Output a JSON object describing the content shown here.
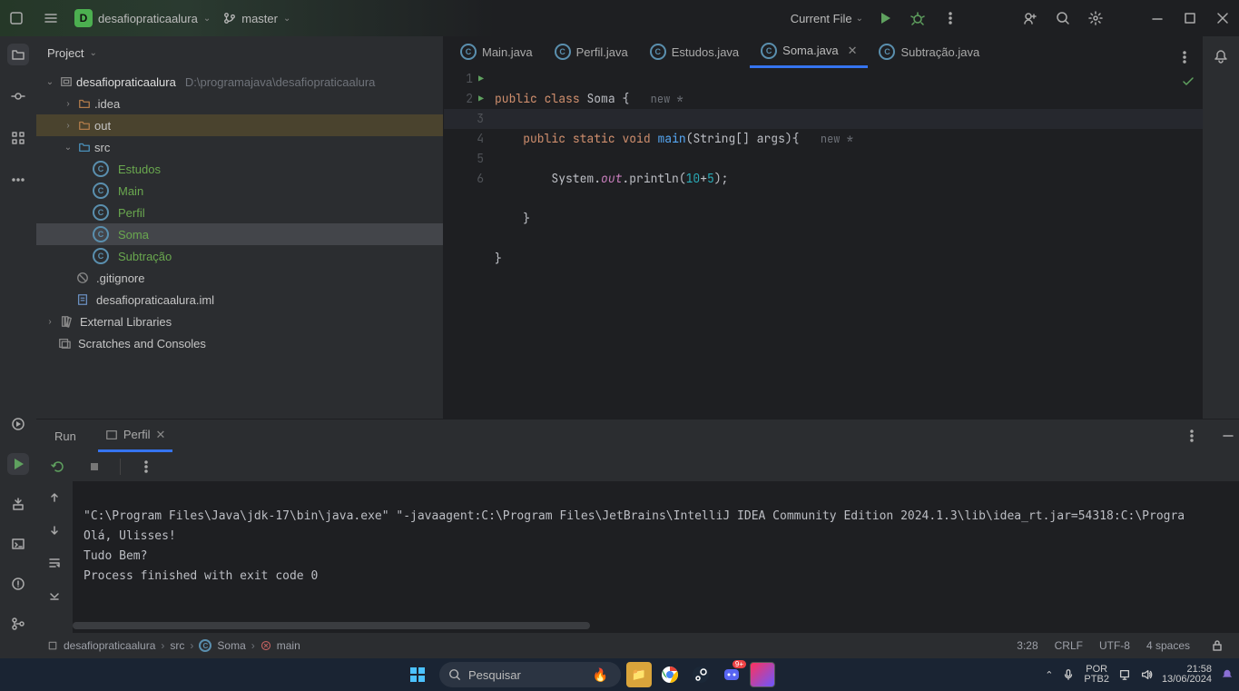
{
  "titlebar": {
    "project_badge": "D",
    "project_name": "desafiopraticaalura",
    "branch": "master",
    "run_config": "Current File"
  },
  "project_panel": {
    "title": "Project",
    "root": "desafiopraticaalura",
    "root_path": "D:\\programajava\\desafiopraticaalura",
    "folders": {
      "idea": ".idea",
      "out": "out",
      "src": "src"
    },
    "files": {
      "estudos": "Estudos",
      "main": "Main",
      "perfil": "Perfil",
      "soma": "Soma",
      "subtracao": "Subtração",
      "gitignore": ".gitignore",
      "iml": "desafiopraticaalura.iml"
    },
    "external": "External Libraries",
    "scratches": "Scratches and Consoles"
  },
  "tabs": [
    {
      "label": "Main.java"
    },
    {
      "label": "Perfil.java"
    },
    {
      "label": "Estudos.java"
    },
    {
      "label": "Soma.java",
      "active": true
    },
    {
      "label": "Subtração.java"
    }
  ],
  "code": {
    "l1": {
      "a": "public",
      "b": "class",
      "c": "Soma {",
      "inlay": "new *"
    },
    "l2": {
      "a": "public",
      "b": "static",
      "c": "void",
      "d": "main",
      "e": "(String[] args){",
      "inlay": "new *"
    },
    "l3": {
      "a": "System.",
      "b": "out",
      "c": ".println(",
      "d": "10",
      "e": "+",
      "f": "5",
      "g": ");"
    },
    "l4": "    }",
    "l5": "}",
    "gutter": [
      "1",
      "2",
      "3",
      "4",
      "5",
      "6"
    ]
  },
  "lower": {
    "tabs": {
      "run": "Run",
      "perfil": "Perfil"
    },
    "console": {
      "l1": "\"C:\\Program Files\\Java\\jdk-17\\bin\\java.exe\" \"-javaagent:C:\\Program Files\\JetBrains\\IntelliJ IDEA Community Edition 2024.1.3\\lib\\idea_rt.jar=54318:C:\\Progra",
      "l2": "Olá, Ulisses!",
      "l3": "Tudo Bem?",
      "l4": "Process finished with exit code 0"
    }
  },
  "breadcrumb": {
    "a": "desafiopraticaalura",
    "b": "src",
    "c": "Soma",
    "d": "main"
  },
  "status": {
    "pos": "3:28",
    "crlf": "CRLF",
    "enc": "UTF-8",
    "indent": "4 spaces"
  },
  "taskbar": {
    "search_placeholder": "Pesquisar",
    "lang1": "POR",
    "lang2": "PTB2",
    "time": "21:58",
    "date": "13/06/2024"
  }
}
